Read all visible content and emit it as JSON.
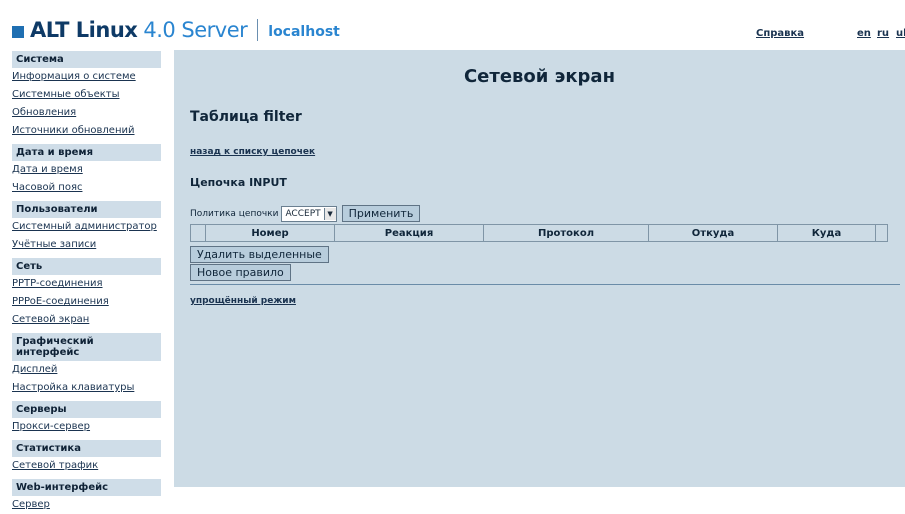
{
  "header": {
    "brand_name": "ALT Linux",
    "brand_version": "4.0 Server",
    "host": "localhost",
    "help_link": "Справка",
    "languages": [
      "en",
      "ru",
      "uk"
    ]
  },
  "sidebar": {
    "sections": [
      {
        "title": "Система",
        "items": [
          "Информация о системе",
          "Системные объекты",
          "Обновления",
          "Источники обновлений"
        ]
      },
      {
        "title": "Дата и время",
        "items": [
          "Дата и время",
          "Часовой пояс"
        ]
      },
      {
        "title": "Пользователи",
        "items": [
          "Системный администратор",
          "Учётные записи"
        ]
      },
      {
        "title": "Сеть",
        "items": [
          "PPTP-соединения",
          "PPPoE-соединения",
          "Сетевой экран"
        ]
      },
      {
        "title": "Графический интерфейс",
        "items": [
          "Дисплей",
          "Настройка клавиатуры"
        ]
      },
      {
        "title": "Серверы",
        "items": [
          "Прокси-сервер"
        ]
      },
      {
        "title": "Статистика",
        "items": [
          "Сетевой трафик"
        ]
      },
      {
        "title": "Web-интерфейс",
        "items": [
          "Сервер"
        ]
      }
    ]
  },
  "main": {
    "title": "Сетевой экран",
    "subtitle": "Таблица filter",
    "back_link": "назад к списку цепочек",
    "chain_title": "Цепочка INPUT",
    "policy_label": "Политика цепочки",
    "policy_value": "ACCEPT",
    "apply_button": "Применить",
    "table_headers": [
      "",
      "Номер",
      "Реакция",
      "Протокол",
      "Откуда",
      "Куда",
      ""
    ],
    "delete_button": "Удалить выделенные",
    "new_rule_button": "Новое правило",
    "simple_mode_link": "упрощённый режим"
  }
}
